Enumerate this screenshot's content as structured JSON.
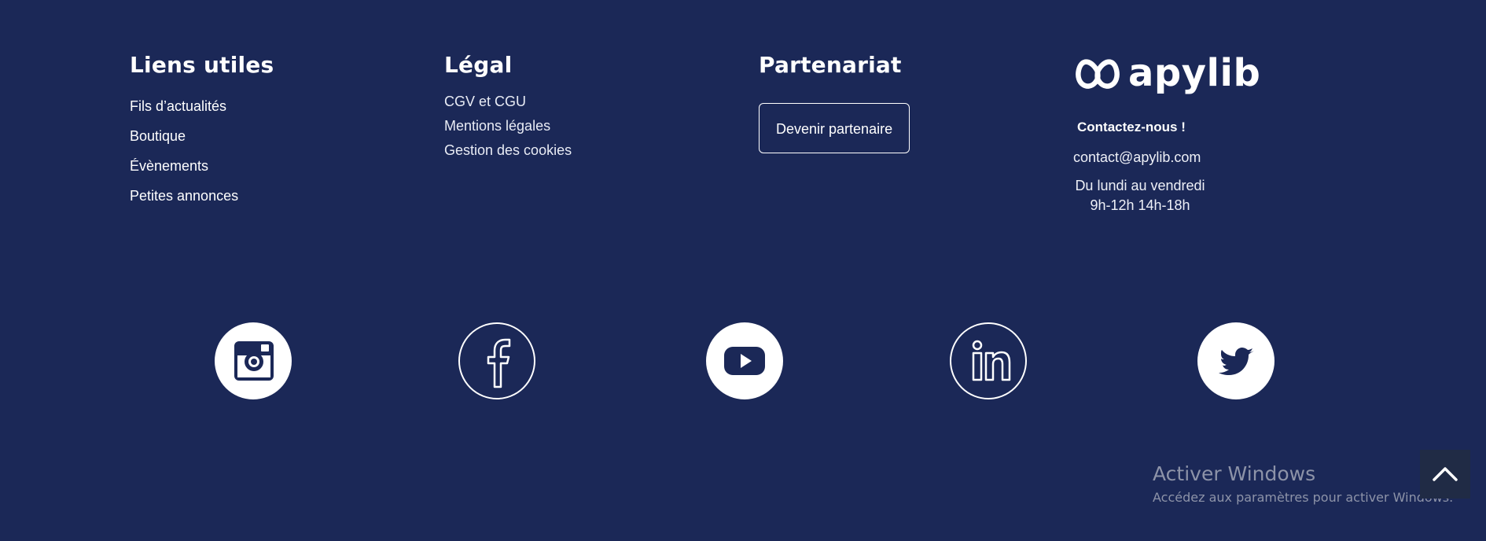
{
  "useful_links": {
    "title": "Liens utiles",
    "items": [
      "Fils d’actualités",
      "Boutique",
      "Évènements",
      "Petites annonces"
    ]
  },
  "legal": {
    "title": "Légal",
    "items": [
      "CGV et CGU",
      "Mentions légales",
      "Gestion des cookies"
    ]
  },
  "partnership": {
    "title": "Partenariat",
    "button_label": "Devenir partenaire"
  },
  "brand": {
    "logo_text": "apylib",
    "logo_icon": "apylib-logo-icon"
  },
  "contact": {
    "title": "Contactez-nous !",
    "email": "contact@apylib.com",
    "hours_line1": "Du lundi au vendredi",
    "hours_line2": "9h-12h 14h-18h"
  },
  "social": [
    {
      "name": "instagram",
      "icon": "instagram-icon"
    },
    {
      "name": "facebook",
      "icon": "facebook-icon"
    },
    {
      "name": "youtube",
      "icon": "youtube-icon"
    },
    {
      "name": "linkedin",
      "icon": "linkedin-icon"
    },
    {
      "name": "twitter",
      "icon": "twitter-icon"
    }
  ],
  "windows_activation": {
    "title": "Activer Windows",
    "subtitle": "Accédez aux paramètres pour activer Windows."
  },
  "colors": {
    "background": "#1b2857",
    "text": "#ffffff",
    "watermark": "#8d93a8",
    "scroll_button": "#202b45"
  }
}
